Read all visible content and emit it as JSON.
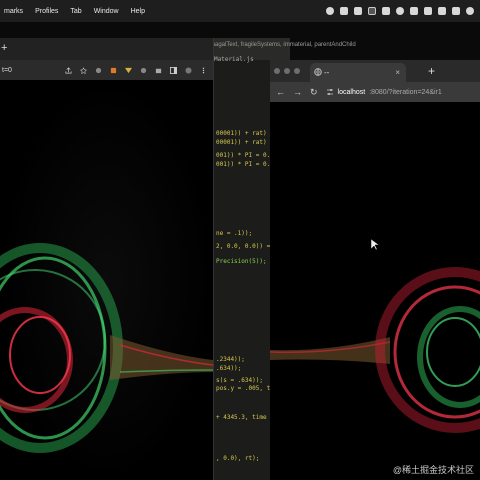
{
  "menubar": {
    "items": [
      "marks",
      "Profiles",
      "Tab",
      "Window",
      "Help"
    ]
  },
  "left_browser": {
    "new_tab": "+",
    "url_fragment": "t=0"
  },
  "editor": {
    "path": "magalText, fragileSystems, immaterial, parentAndChild",
    "tab_name": "Material.js",
    "lines": [
      "00001)) + rat) +",
      "00001)) + rat) +",
      "001)) * PI = 0.0;",
      "001)) * PI = 0.0;",
      "ne = .1));",
      "2, 0.0, 0.0)) = 1",
      "Precision(5));",
      ".2344));",
      ".634));",
      "s(s = .634));",
      "pos.y = .005, ti",
      "+ 4345.3, time +",
      ", 0.0), rt);"
    ]
  },
  "right_browser": {
    "tab_title": "--",
    "tab_close": "×",
    "new_tab": "+",
    "url_host": "localhost",
    "url_rest": ":8080/?iteration=24&ir1"
  },
  "watermark": "@稀土掘金技术社区",
  "colors": {
    "particles_green": "#3ed36a",
    "particles_red": "#e0263a",
    "code_yellow": "#d7c84f"
  }
}
